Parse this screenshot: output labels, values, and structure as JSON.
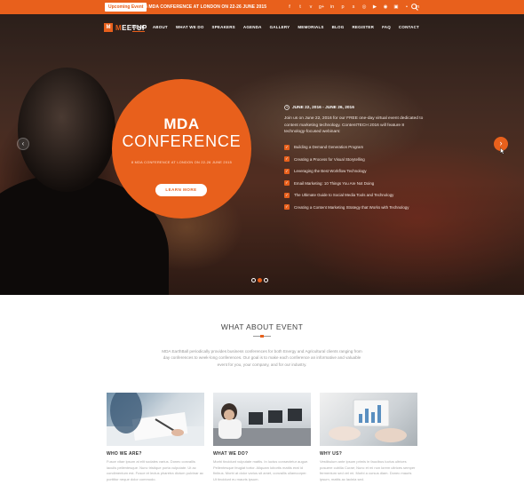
{
  "topbar": {
    "badge": "Upcoming Event",
    "news": "8 MDA CONFERENCE AT LONDON ON 22-26 JUNE 2015",
    "social_icons": [
      "facebook-icon",
      "twitter-icon",
      "vimeo-icon",
      "google-plus-icon",
      "linkedin-icon",
      "pinterest-icon",
      "skype-icon",
      "dribbble-icon",
      "youtube-icon",
      "rss-icon",
      "instagram-icon",
      "flickr-icon",
      "linkedin-alt-icon"
    ],
    "social_glyphs": [
      "f",
      "t",
      "v",
      "g+",
      "in",
      "p",
      "s",
      "◎",
      "▶",
      "◉",
      "▣",
      "•",
      "in"
    ]
  },
  "nav": {
    "logo_mark": "M",
    "logo_accent": "M",
    "logo_rest": "EETUP",
    "items": [
      "HOME",
      "ABOUT",
      "WHAT WE DO",
      "SPEAKERS",
      "AGENDA",
      "GALLERY",
      "MEMORIALS",
      "BLOG",
      "REGISTER",
      "FAQ",
      "CONTACT"
    ],
    "active": "HOME"
  },
  "hero": {
    "circle_title": "MDA",
    "circle_subtitle": "CONFERENCE",
    "circle_line": "8 MDA CONFERENCE AT LONDON ON 22-26 JUNE 2015",
    "cta": "LEARN MORE",
    "date": "JUNE 22, 2016 - JUNE 26, 2016",
    "intro": "Join us on June 22, 2016 for our FREE one-day virtual event dedicated to content marketing technology. ContentTECH 2016 will feature 8 technology-focused webinars:",
    "items": [
      "Building a Demand Generation Program",
      "Creating a Process for Visual Storytelling",
      "Leveraging the Best Workflow Technology",
      "Email Marketing: 10 Things You Are Not Doing",
      "The Ultimate Guide to Social Media Tools and Technology",
      "Creating a Content Marketing Strategy that Works with Technology"
    ],
    "slides": 3,
    "active_slide": 1
  },
  "about": {
    "title": "WHAT ABOUT EVENT",
    "description": "MDA EarthBall periodically provides business conferences for both Energy and Agricultural clients ranging from day conferences to week-long conferences. Our goal is to make each conference an informative and valuable event for you, your company, and for our industry.",
    "cards": [
      {
        "title": "WHO WE ARE?",
        "text": "Fusce vitae ipsum at elit sodales varius. Donec convallis iaculis pellentesque. Nunc tristique porta vulputate. Ut ac condimentum est. Fusce et lectus pharetra dictum pulvinar ac porttitor neque dolor commodo."
      },
      {
        "title": "WHAT WE DO?",
        "text": "Morbi tincidunt vulputate mattis. In luctus consectetur augue. Pellentesque feugiat tortor. Aliquam lobortis mattis erat id finibus. Morbi at dolor varius sit amet, convallis ullamcorper. Ut tincidunt eu mauris ipsum."
      },
      {
        "title": "WHY US?",
        "text": "Vestibulum ante ipsum primis in faucibus luctus ultrices posuere cubilia Curae; Nunc et mi non lorem ultrices semper fermentum sed vel mi. Morbi a cursus diam. Donec mauris ipsum, mattis ac lacinia sed."
      }
    ]
  },
  "colors": {
    "accent": "#e8601c",
    "text": "#333333",
    "muted": "#999999"
  }
}
